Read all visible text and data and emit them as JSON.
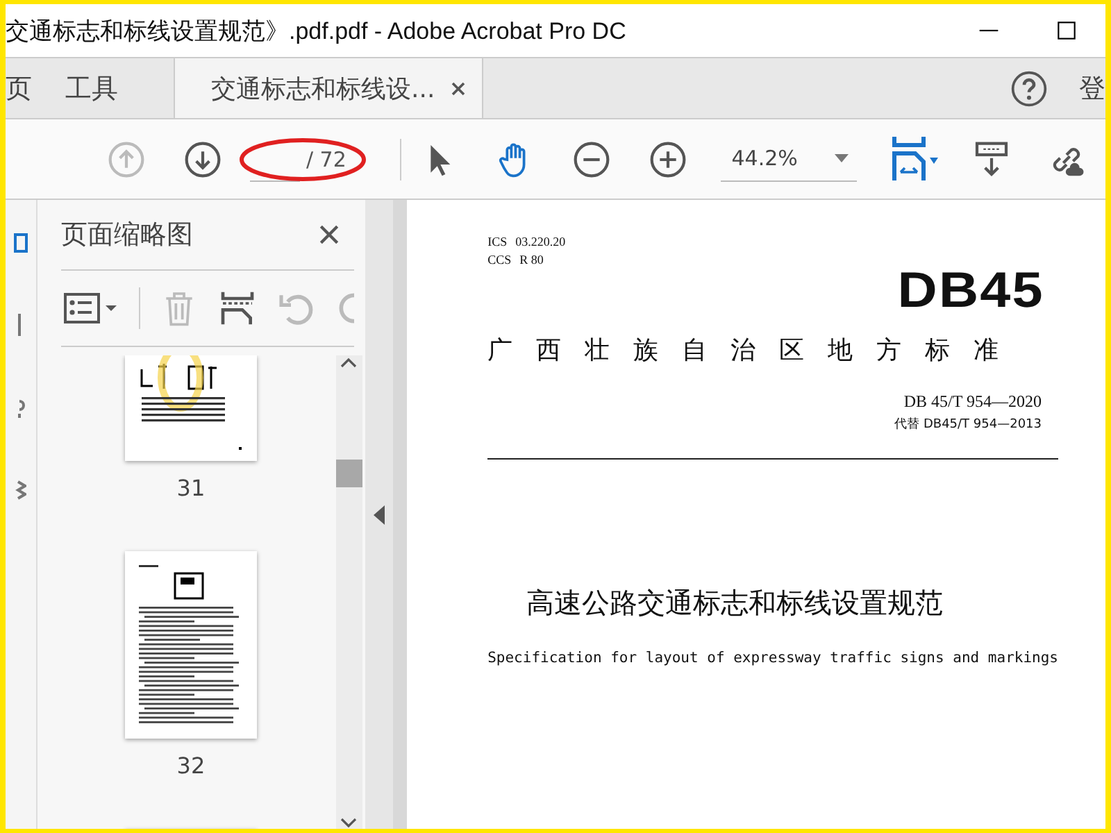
{
  "window": {
    "title": "交通标志和标线设置规范》.pdf.pdf - Adobe Acrobat Pro DC"
  },
  "tabs": [
    {
      "label": "页",
      "selected": false
    },
    {
      "label": "工具",
      "selected": false
    },
    {
      "label": "交通标志和标线设...",
      "selected": true
    }
  ],
  "account": {
    "label": "登"
  },
  "toolbar": {
    "page_total": "/ 72",
    "zoom": "44.2%"
  },
  "thumbnails_panel": {
    "title": "页面缩略图",
    "thumbnails": [
      {
        "page": "31",
        "kind": "figure"
      },
      {
        "page": "32",
        "kind": "text"
      }
    ]
  },
  "document": {
    "ics_label": "ICS",
    "ics_code": "03.220.20",
    "ccs_label": "CCS",
    "ccs_code": "R 80",
    "logo": "DB45",
    "authority": "广西壮族自治区地方标准",
    "standard_number": "DB 45/T 954—2020",
    "replaces": "代替 DB45/T 954—2013",
    "title": "高速公路交通标志和标线设置规范",
    "subtitle": "Specification for layout of expressway traffic signs and markings"
  }
}
